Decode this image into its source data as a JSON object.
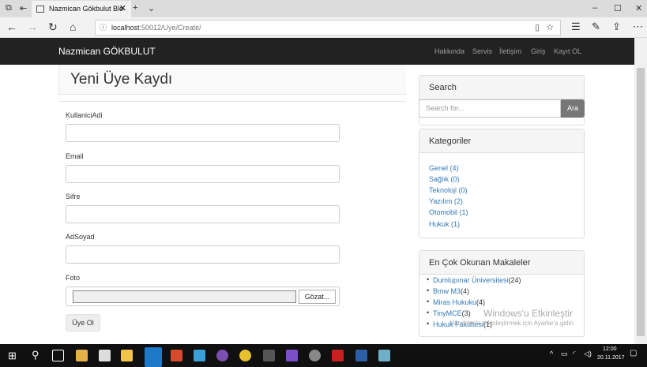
{
  "browser": {
    "tab_title": "Nazmican Gökbulut Blo",
    "url_host": "localhost",
    "url_rest": ":50012/Uye/Create/"
  },
  "navbar": {
    "brand": "Nazmican GÖKBULUT",
    "links": [
      "Hakkında",
      "Servis",
      "İletişim",
      "Giriş",
      "Kayıt OL"
    ]
  },
  "form": {
    "title": "Yeni Üye Kaydı",
    "fields": [
      {
        "label": "KullaniciAdi",
        "value": ""
      },
      {
        "label": "Email",
        "value": ""
      },
      {
        "label": "Sifre",
        "value": ""
      },
      {
        "label": "AdSoyad",
        "value": ""
      }
    ],
    "file_label": "Foto",
    "browse_label": "Gözat...",
    "submit_label": "Üye Ol"
  },
  "sidebar": {
    "search_title": "Search",
    "search_placeholder": "Search for...",
    "search_button": "Ara",
    "categories_title": "Kategoriler",
    "categories": [
      "Genel (4)",
      "Sağlık (0)",
      "Teknoloji (0)",
      "Yazılım (2)",
      "Otomobil (1)",
      "Hukuk (1)"
    ],
    "popular_title": "En Çok Okunan Makaleler",
    "popular": [
      {
        "name": "Dumlupınar Üniversitesi",
        "count": "(24)"
      },
      {
        "name": "Bmw M3",
        "count": "(4)"
      },
      {
        "name": "Miras Hukuku",
        "count": "(4)"
      },
      {
        "name": "TinyMCE",
        "count": "(3)"
      },
      {
        "name": "Hukuk Fakültesi",
        "count": "(1)"
      }
    ]
  },
  "watermark": {
    "line1": "Windows'u Etkinleştir",
    "line2": "Windows'u etkinleştirmek için Ayarlar'a gidin."
  },
  "taskbar": {
    "time": "12:00",
    "date": "20.11.2017"
  }
}
